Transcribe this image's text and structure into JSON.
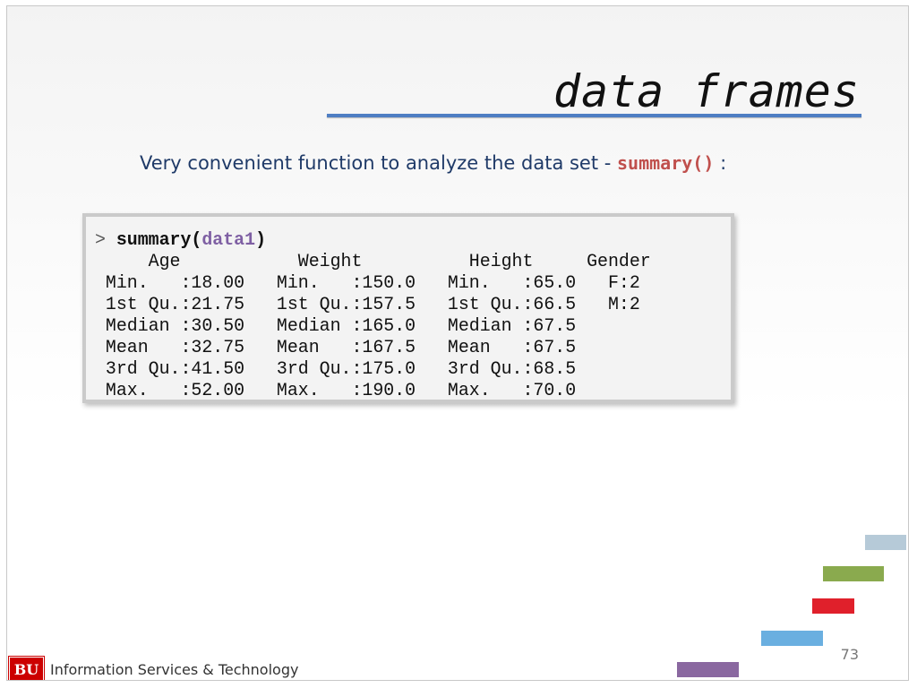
{
  "slide": {
    "title": "data frames",
    "subtitle_text": "Very convenient function to analyze the data set - ",
    "subtitle_code": "summary()",
    "subtitle_suffix": " :",
    "page_number": "73"
  },
  "console": {
    "prompt": ">",
    "command": "summary(",
    "argument": "data1",
    "command_close": ")",
    "output_lines": [
      "     Age           Weight          Height     Gender",
      " Min.   :18.00   Min.   :150.0   Min.   :65.0   F:2  ",
      " 1st Qu.:21.75   1st Qu.:157.5   1st Qu.:66.5   M:2  ",
      " Median :30.50   Median :165.0   Median :67.5        ",
      " Mean   :32.75   Mean   :167.5   Mean   :67.5        ",
      " 3rd Qu.:41.50   3rd Qu.:175.0   3rd Qu.:68.5        ",
      " Max.   :52.00   Max.   :190.0   Max.   :70.0        "
    ]
  },
  "footer": {
    "logo_text": "BU",
    "org_name": "Information Services & Technology"
  },
  "colors": {
    "title_rule": "#4f7ec3",
    "subtitle_text": "#1f3a68",
    "code_highlight": "#c0504d",
    "argument": "#7e5fa3",
    "deco_light_blue": "#b6cad8",
    "deco_green": "#8aaa4e",
    "deco_red": "#e0202b",
    "deco_blue": "#6aafe0",
    "deco_purple": "#8a68a0",
    "logo_red": "#cc0000"
  }
}
